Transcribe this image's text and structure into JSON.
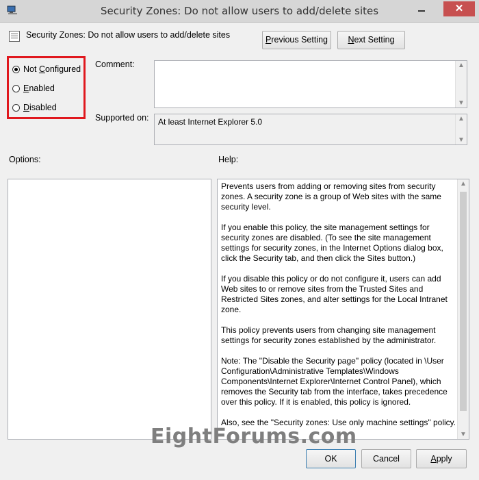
{
  "window": {
    "title": "Security Zones: Do not allow users to add/delete sites",
    "close_glyph": "✕"
  },
  "header": {
    "policy_title": "Security Zones: Do not allow users to add/delete sites",
    "previous_prefix": "P",
    "previous_rest": "revious Setting",
    "next_prefix": "N",
    "next_rest": "ext Setting"
  },
  "state": {
    "options": [
      {
        "pre": "Not ",
        "key": "C",
        "post": "onfigured",
        "checked": true
      },
      {
        "pre": "",
        "key": "E",
        "post": "nabled",
        "checked": false
      },
      {
        "pre": "",
        "key": "D",
        "post": "isabled",
        "checked": false
      }
    ]
  },
  "comment": {
    "label": "Comment:",
    "value": ""
  },
  "supported": {
    "label": "Supported on:",
    "value": "At least Internet Explorer 5.0"
  },
  "options_label": "Options:",
  "help": {
    "label": "Help:",
    "paragraphs": [
      "Prevents users from adding or removing sites from security zones. A security zone is a group of Web sites with the same security level.",
      "If you enable this policy, the site management settings for security zones are disabled. (To see the site management settings for security zones, in the Internet Options dialog box, click the Security tab, and then click the Sites button.)",
      "If you disable this policy or do not configure it, users can add Web sites to or remove sites from the Trusted Sites and Restricted Sites zones, and alter settings for the Local Intranet zone.",
      "This policy prevents users from changing site management settings for security zones established by the administrator.",
      "Note:  The \"Disable the Security page\" policy (located in \\User Configuration\\Administrative Templates\\Windows Components\\Internet Explorer\\Internet Control Panel), which removes the Security tab from the interface, takes precedence over this policy. If it is enabled, this policy is ignored.",
      "Also, see the \"Security zones: Use only machine settings\" policy."
    ]
  },
  "watermark": "EightForums.com",
  "footer": {
    "ok": "OK",
    "cancel": "Cancel",
    "apply_prefix": "A",
    "apply_rest": "pply"
  },
  "colors": {
    "highlight_border": "#e0181e",
    "close_button": "#c75050"
  }
}
